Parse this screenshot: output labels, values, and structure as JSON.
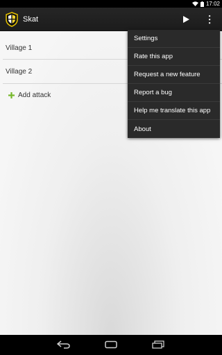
{
  "status_bar": {
    "time": "17:02"
  },
  "app": {
    "title": "Skat"
  },
  "action_bar": {
    "icons": [
      "app-logo-icon",
      "play-icon",
      "overflow-menu-icon"
    ]
  },
  "list": {
    "items": [
      {
        "label": "Village 1"
      },
      {
        "label": "Village 2"
      }
    ],
    "add_label": "Add attack"
  },
  "menu": {
    "items": [
      {
        "label": "Settings"
      },
      {
        "label": "Rate this app"
      },
      {
        "label": "Request a new feature"
      },
      {
        "label": "Report a bug"
      },
      {
        "label": "Help me translate this app"
      },
      {
        "label": "About"
      }
    ]
  },
  "nav_bar": {
    "icons": [
      "back-icon",
      "home-icon",
      "recent-apps-icon"
    ]
  },
  "colors": {
    "accent_green": "#76b82a",
    "menu_bg": "#2a2a2a",
    "action_bar_bg": "#222222"
  }
}
